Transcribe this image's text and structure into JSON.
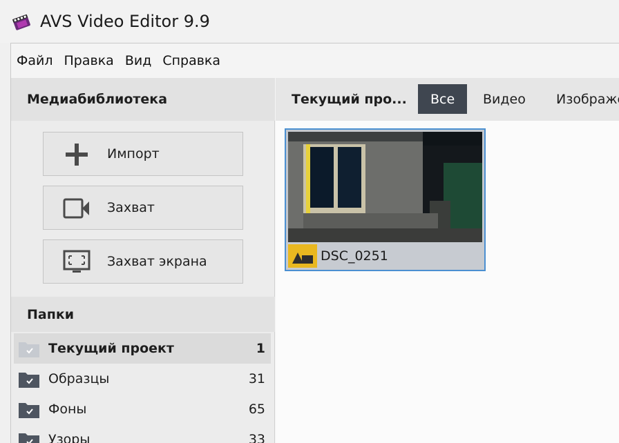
{
  "app": {
    "title": "AVS Video Editor 9.9"
  },
  "menu": [
    "Файл",
    "Правка",
    "Вид",
    "Справка"
  ],
  "library": {
    "header": "Медиабиблиотека",
    "buttons": [
      {
        "label": "Импорт",
        "icon": "plus-icon"
      },
      {
        "label": "Захват",
        "icon": "camera-icon"
      },
      {
        "label": "Захват экрана",
        "icon": "screen-capture-icon"
      }
    ]
  },
  "folders": {
    "header": "Папки",
    "items": [
      {
        "label": "Текущий проект",
        "count": "1",
        "active": true
      },
      {
        "label": "Образцы",
        "count": "31"
      },
      {
        "label": "Фоны",
        "count": "65"
      },
      {
        "label": "Узоры",
        "count": "33"
      }
    ]
  },
  "content": {
    "title": "Текущий про...",
    "tabs": [
      {
        "label": "Все",
        "active": true
      },
      {
        "label": "Видео"
      },
      {
        "label": "Изображения"
      }
    ],
    "items": [
      {
        "name": "DSC_0251",
        "type_icon": "video-file-icon"
      }
    ]
  },
  "colors": {
    "accent": "#4a8fd1",
    "tab_active": "#3f4650",
    "type_badge": "#e9b820"
  }
}
